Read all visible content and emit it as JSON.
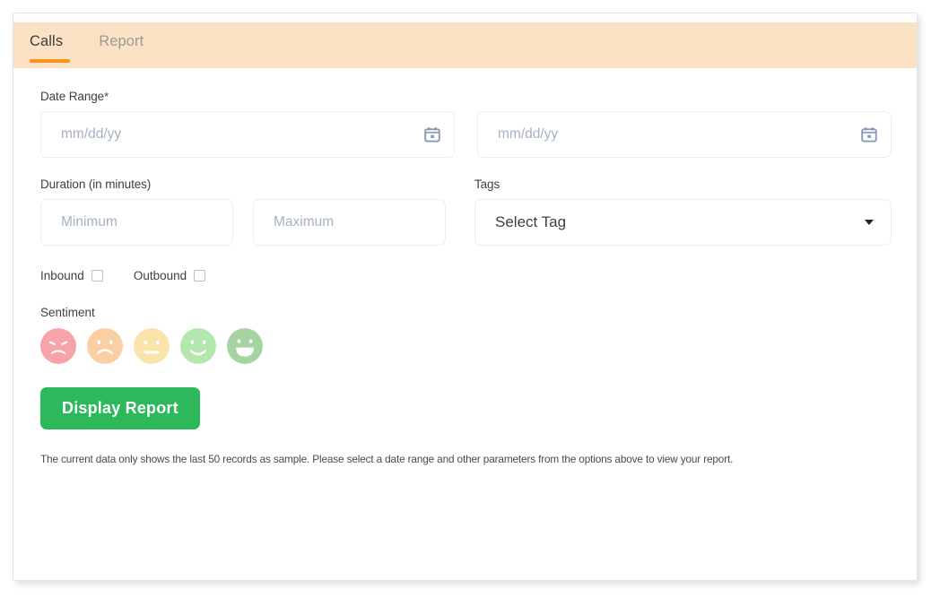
{
  "tabs": [
    {
      "label": "Calls",
      "active": true
    },
    {
      "label": "Report",
      "active": false
    }
  ],
  "form": {
    "date_range": {
      "label": "Date Range",
      "required_marker": "*",
      "start_placeholder": "mm/dd/yy",
      "start_value": "",
      "end_placeholder": "mm/dd/yy",
      "end_value": "",
      "icon": "calendar-icon"
    },
    "duration": {
      "label": "Duration (in minutes)",
      "min_placeholder": "Minimum",
      "min_value": "",
      "max_placeholder": "Maximum",
      "max_value": ""
    },
    "tags": {
      "label": "Tags",
      "selected": "Select Tag",
      "caret_icon": "chevron-down-icon"
    },
    "direction": {
      "inbound_label": "Inbound",
      "inbound_checked": false,
      "outbound_label": "Outbound",
      "outbound_checked": false
    },
    "sentiment": {
      "label": "Sentiment",
      "options": [
        {
          "name": "angry-face-icon",
          "color": "#f6a3a9"
        },
        {
          "name": "sad-face-icon",
          "color": "#fbcfa4"
        },
        {
          "name": "neutral-face-icon",
          "color": "#fbe4ac"
        },
        {
          "name": "smile-face-icon",
          "color": "#b3e7ad"
        },
        {
          "name": "grin-face-icon",
          "color": "#a6d3a2"
        }
      ]
    },
    "submit_label": "Display Report",
    "submit_color": "#2eb85c"
  },
  "footnote": "The current data only shows the last 50 records as sample. Please select a date range and other parameters from the options above to view your report.",
  "colors": {
    "tabbar_background": "#fbe2c4",
    "active_tab_underline": "#f7941e",
    "input_border": "#eaedf2",
    "calendar_icon": "#8a99b5"
  }
}
